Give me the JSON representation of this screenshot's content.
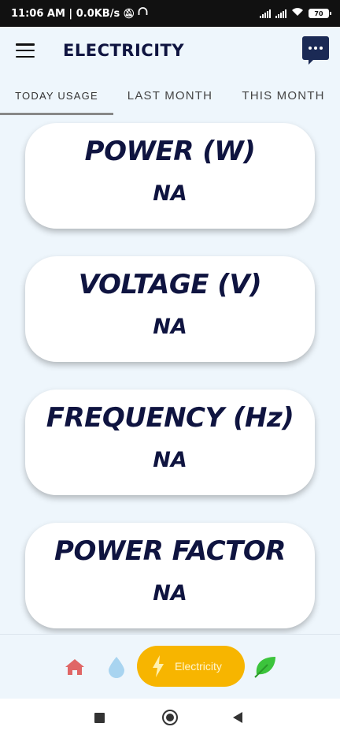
{
  "status_bar": {
    "time_speed": "11:06 AM | 0.0KB/s",
    "battery": "70"
  },
  "app_bar": {
    "title": "ELECTRICITY",
    "menu_icon": "hamburger-menu-icon",
    "chat_icon": "chat-bubble-icon"
  },
  "tabs": [
    {
      "label": "TODAY USAGE",
      "active": true
    },
    {
      "label": "LAST MONTH",
      "active": false
    },
    {
      "label": "THIS MONTH",
      "active": false
    }
  ],
  "cards": [
    {
      "label": "POWER (W)",
      "value": "NA"
    },
    {
      "label": "VOLTAGE (V)",
      "value": "NA"
    },
    {
      "label": "FREQUENCY (Hz)",
      "value": "NA"
    },
    {
      "label": "POWER FACTOR",
      "value": "NA"
    }
  ],
  "bottom_nav": {
    "items": [
      {
        "icon": "home-icon",
        "color": "#e06666"
      },
      {
        "icon": "water-drop-icon",
        "color": "#a8d4f0"
      },
      {
        "icon": "lightning-bolt-icon",
        "label": "Electricity",
        "active": true,
        "color": "#f7b500"
      },
      {
        "icon": "leaf-icon",
        "color": "#3cc43c"
      }
    ]
  },
  "colors": {
    "accent": "#f7b500",
    "text_dark": "#0f1440",
    "background": "#eef6fc"
  }
}
